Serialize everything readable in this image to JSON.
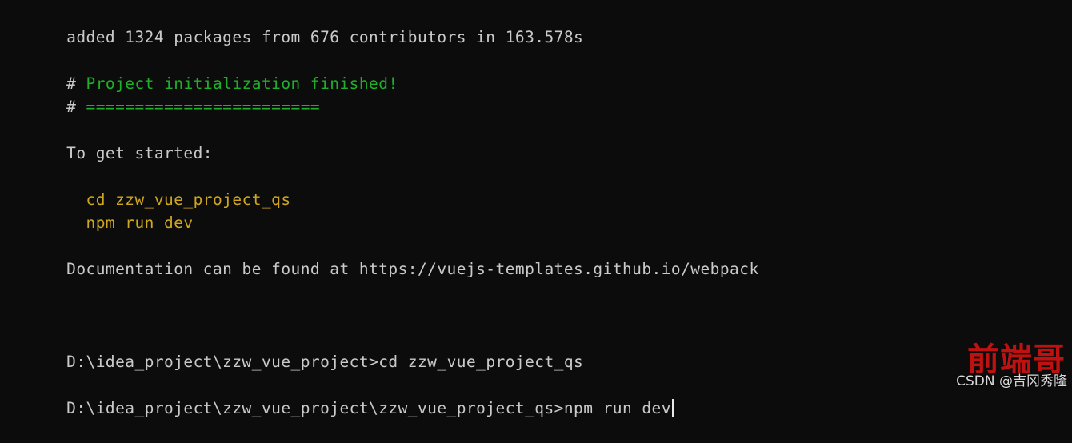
{
  "terminal": {
    "background_color": "#0c0c0c",
    "foreground_color": "#cccccc",
    "green_color": "#1faf28",
    "yellow_color": "#cfa61d",
    "lines": [
      {
        "id": "install-summary",
        "text": "added 1324 packages from 676 contributors in 163.578s"
      },
      {
        "id": "blank-1",
        "text": ""
      },
      {
        "id": "banner-title-hash",
        "text": "# "
      },
      {
        "id": "banner-title",
        "text": "Project initialization finished!"
      },
      {
        "id": "banner-rule-hash",
        "text": "# "
      },
      {
        "id": "banner-rule",
        "text": "========================"
      },
      {
        "id": "blank-2",
        "text": ""
      },
      {
        "id": "get-started-heading",
        "text": "To get started:"
      },
      {
        "id": "blank-3",
        "text": ""
      },
      {
        "id": "cmd-cd",
        "text": "  cd zzw_vue_project_qs"
      },
      {
        "id": "cmd-npm-run-dev",
        "text": "  npm run dev"
      },
      {
        "id": "blank-4",
        "text": ""
      },
      {
        "id": "docs-line",
        "text": "Documentation can be found at https://vuejs-templates.github.io/webpack"
      },
      {
        "id": "blank-5",
        "text": ""
      },
      {
        "id": "blank-6",
        "text": ""
      },
      {
        "id": "blank-7",
        "text": ""
      },
      {
        "id": "prompt-1",
        "text": "D:\\idea_project\\zzw_vue_project>cd zzw_vue_project_qs"
      },
      {
        "id": "blank-8",
        "text": ""
      },
      {
        "id": "prompt-2",
        "text": "D:\\idea_project\\zzw_vue_project\\zzw_vue_project_qs>npm run dev"
      }
    ],
    "prompt_1": {
      "path": "D:\\idea_project\\zzw_vue_project>",
      "command": "cd zzw_vue_project_qs"
    },
    "prompt_2": {
      "path": "D:\\idea_project\\zzw_vue_project\\zzw_vue_project_qs>",
      "command": "npm run dev"
    },
    "install_summary": {
      "full_text": "added 1324 packages from 676 contributors in 163.578s",
      "packages": "1324",
      "contributors": "676",
      "duration": "163.578s"
    },
    "banner": {
      "hash": "#",
      "title": "Project initialization finished!",
      "rule": "========================"
    },
    "get_started": {
      "heading": "To get started:",
      "steps": [
        "cd zzw_vue_project_qs",
        "npm run dev"
      ]
    },
    "documentation": {
      "prefix": "Documentation can be found at ",
      "url": "https://vuejs-templates.github.io/webpack",
      "full_text": "Documentation can be found at https://vuejs-templates.github.io/webpack"
    }
  },
  "watermark": {
    "big_text": "前端哥",
    "small_text": "CSDN @吉冈秀隆",
    "big_color": "#c01111",
    "small_color": "#d8d8d8"
  }
}
